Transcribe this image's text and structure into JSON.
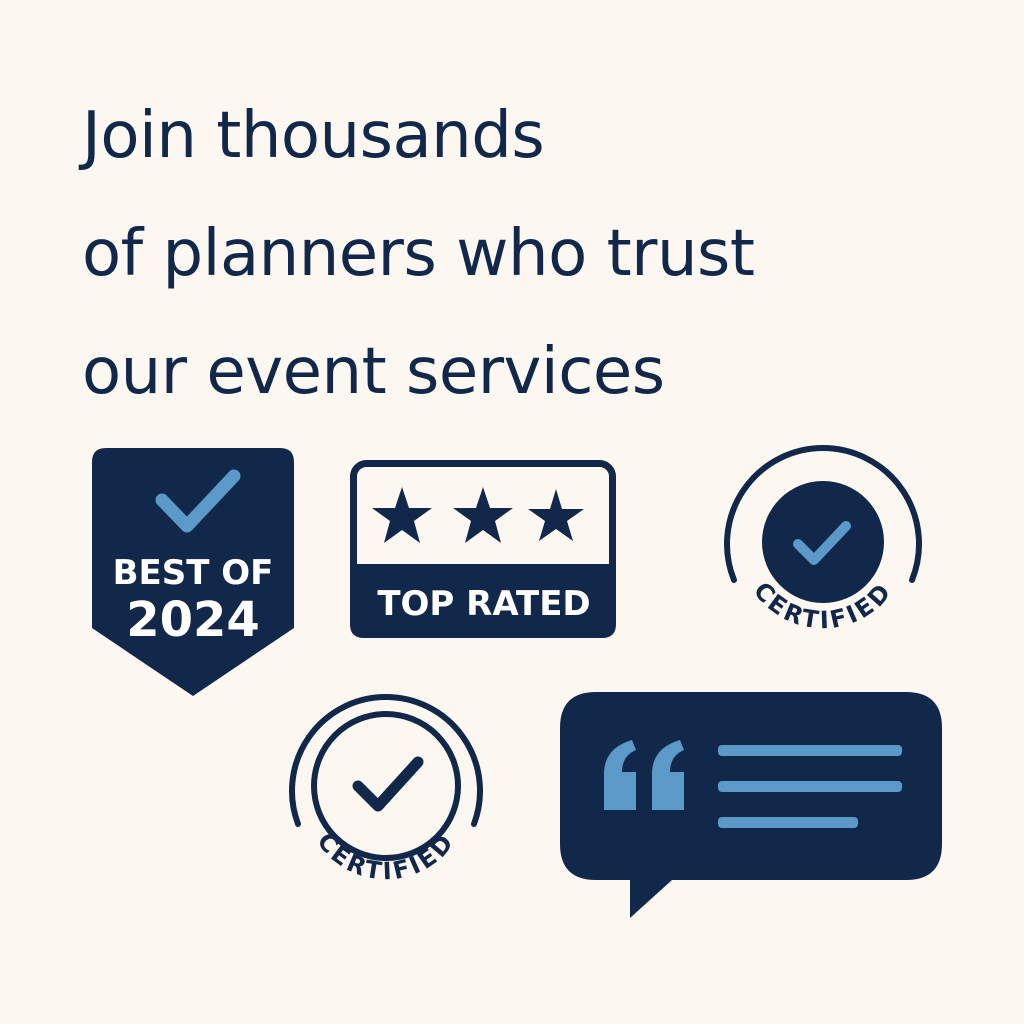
{
  "headline": {
    "lines": [
      "Join thousands",
      "of planners who trust",
      "our event services"
    ]
  },
  "badges": {
    "best_of": {
      "line1": "BEST OF",
      "line2": "2024",
      "icon": "checkmark-icon"
    },
    "top_rated": {
      "label": "TOP RATED",
      "stars": 3,
      "icon": "star-icon"
    },
    "certified_right": {
      "label": "CERTIFIED",
      "icon": "checkmark-icon"
    },
    "certified_left": {
      "label": "CERTIFIED",
      "icon": "checkmark-icon"
    },
    "testimonial": {
      "icon": "quote-icon"
    }
  },
  "colors": {
    "background": "#fcf7f0",
    "navy": "#11284a",
    "accent_blue": "#5b9ac8"
  }
}
